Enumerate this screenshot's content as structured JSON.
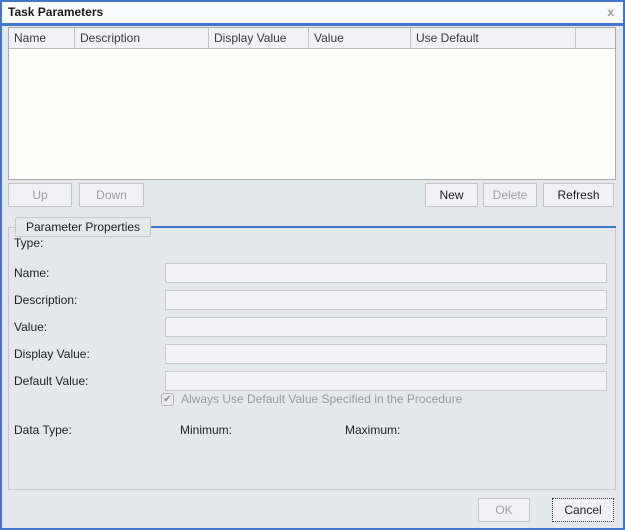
{
  "window": {
    "title": "Task Parameters",
    "close_glyph": "x"
  },
  "table": {
    "columns": [
      "Name",
      "Description",
      "Display Value",
      "Value",
      "Use Default",
      ""
    ],
    "rows": []
  },
  "list_buttons": {
    "up": "Up",
    "down": "Down",
    "new": "New",
    "delete": "Delete",
    "refresh": "Refresh"
  },
  "properties": {
    "group_title": "Parameter Properties",
    "type_label": "Type:",
    "fields": {
      "name": {
        "label": "Name:",
        "value": ""
      },
      "description": {
        "label": "Description:",
        "value": ""
      },
      "value": {
        "label": "Value:",
        "value": ""
      },
      "display_value": {
        "label": "Display Value:",
        "value": ""
      },
      "default_value": {
        "label": "Default Value:",
        "value": ""
      }
    },
    "checkbox": {
      "label": "Always Use Default Value Specified in the Procedure",
      "checked": true,
      "glyph": "✔"
    },
    "info_labels": {
      "data_type": "Data Type:",
      "minimum": "Minimum:",
      "maximum": "Maximum:"
    }
  },
  "footer": {
    "ok": "OK",
    "cancel": "Cancel"
  },
  "colors": {
    "accent_blue": "#4377cd",
    "dialog_bg": "#e5e8ea",
    "table_body_bg": "#fdfdfa",
    "disabled_text": "#a09fa6"
  }
}
